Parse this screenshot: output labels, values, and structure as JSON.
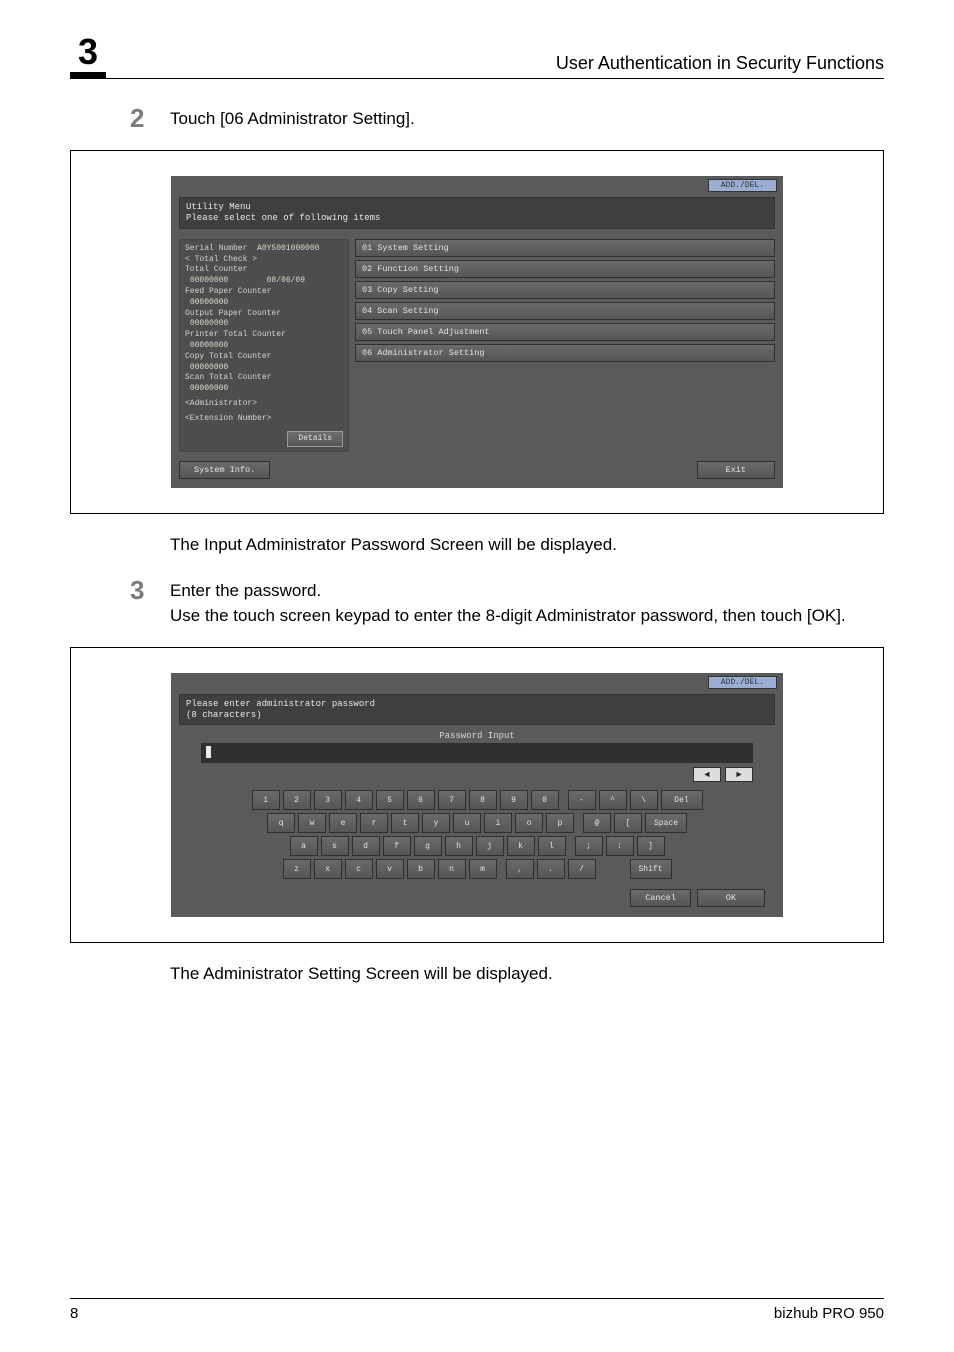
{
  "header": {
    "chapter_number": "3",
    "chapter_title": "User Authentication in Security Functions"
  },
  "steps": {
    "s2": {
      "num": "2",
      "text": "Touch [06 Administrator Setting]."
    },
    "s2_follow": "The Input Administrator Password Screen will be displayed.",
    "s3": {
      "num": "3",
      "line1": "Enter the password.",
      "line2": "Use the touch screen keypad to enter the 8-digit Administrator password, then touch [OK]."
    },
    "s3_follow": "The Administrator Setting Screen will be displayed."
  },
  "panel1": {
    "add_del": "ADD./DEL.",
    "msg_line1": "Utility Menu",
    "msg_line2": "Please select one of following items",
    "info": {
      "serial_label": "Serial Number",
      "serial_value": "A0Y5001000000",
      "total_check": "< Total Check >",
      "total_counter_label": "Total Counter",
      "total_counter_value": "00000000",
      "date": "08/06/09",
      "feed_label": "Feed Paper Counter",
      "feed_value": "00000000",
      "output_label": "Output Paper Counter",
      "output_value": "00000000",
      "printer_label": "Printer Total Counter",
      "printer_value": "00000000",
      "copy_label": "Copy Total Counter",
      "copy_value": "00000000",
      "scan_label": "Scan Total Counter",
      "scan_value": "00000000",
      "admin_label": "<Administrator>",
      "ext_label": "<Extension Number>",
      "details_btn": "Details"
    },
    "menu": {
      "m1": "01 System Setting",
      "m2": "02 Function Setting",
      "m3": "03 Copy Setting",
      "m4": "04 Scan Setting",
      "m5": "05 Touch Panel Adjustment",
      "m6": "06 Administrator Setting"
    },
    "bottom": {
      "sysinfo": "System Info.",
      "exit": "Exit"
    }
  },
  "panel2": {
    "add_del": "ADD./DEL.",
    "msg_line1": "Please enter administrator password",
    "msg_line2": "(8 characters)",
    "pw_label": "Password Input",
    "arrows": {
      "left": "◄",
      "right": "►"
    },
    "keys": {
      "row1": [
        "1",
        "2",
        "3",
        "4",
        "5",
        "6",
        "7",
        "8",
        "9",
        "0",
        "-",
        "^",
        "\\"
      ],
      "row1_del": "Del",
      "row2": [
        "q",
        "w",
        "e",
        "r",
        "t",
        "y",
        "u",
        "i",
        "o",
        "p",
        "@",
        "["
      ],
      "row2_space": "Space",
      "row3": [
        "a",
        "s",
        "d",
        "f",
        "g",
        "h",
        "j",
        "k",
        "l",
        ";",
        ":",
        "]"
      ],
      "row4": [
        "z",
        "x",
        "c",
        "v",
        "b",
        "n",
        "m",
        ",",
        ".",
        "/"
      ],
      "row4_shift": "Shift"
    },
    "bottom": {
      "cancel": "Cancel",
      "ok": "OK"
    }
  },
  "footer": {
    "page": "8",
    "product": "bizhub PRO 950"
  }
}
